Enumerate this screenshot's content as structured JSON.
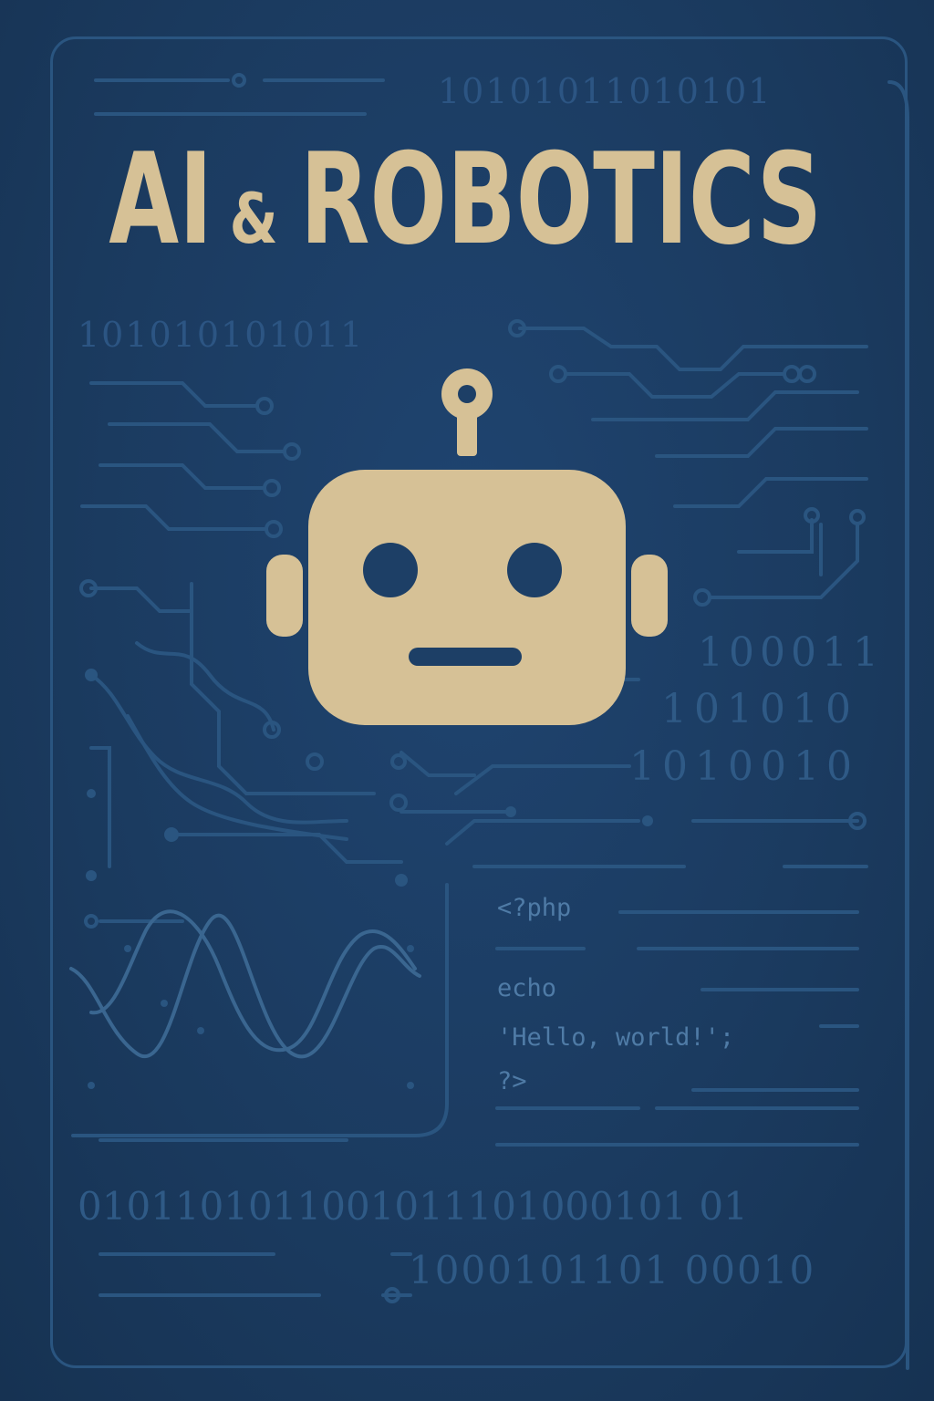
{
  "cover": {
    "title_part1": "AI",
    "title_amp": "&",
    "title_part2": "ROBOTICS"
  },
  "binary": {
    "top": "10101011010101",
    "upper_left": "101010101011",
    "right_1": "100011",
    "right_2": "101010",
    "right_3": "1010010",
    "bottom_1": "0101101011001011101000101 01",
    "bottom_2": "1000101101 00010"
  },
  "code_panel": {
    "line1": "<?php",
    "line2": "echo",
    "line3": "'Hello, world!';",
    "line4": "?>"
  },
  "colors": {
    "background": "#1b3b5f",
    "accent": "#d6c196",
    "circuit": "#2a5580",
    "code_text": "#4f7ba6"
  }
}
